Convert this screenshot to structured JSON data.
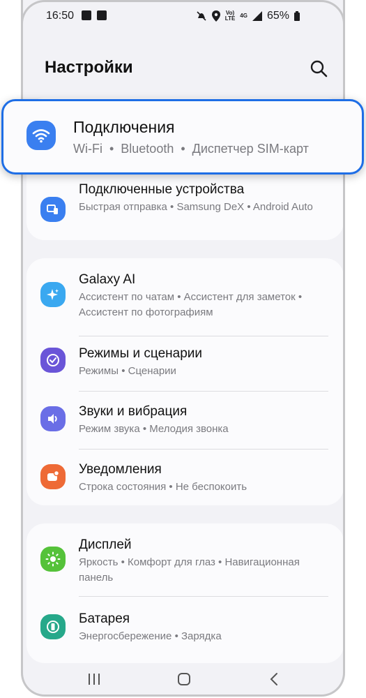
{
  "status_bar": {
    "time": "16:50",
    "sig_label": "Vo)\nLTE",
    "net": "4G",
    "battery": "65%"
  },
  "header": {
    "title": "Настройки"
  },
  "highlighted": {
    "title": "Подключения",
    "subtitle": "Wi-Fi  •  Bluetooth  •  Диспетчер SIM-карт",
    "icon_color": "#3a7ff0"
  },
  "group1": [
    {
      "title": "Подключенные устройства",
      "subtitle": "Быстрая отправка  •  Samsung DeX  •  Android Auto",
      "icon": "devices-icon",
      "color": "#3a7ff0"
    }
  ],
  "group2": [
    {
      "title": "Galaxy AI",
      "subtitle": "Ассистент по чатам  •  Ассистент для заметок  •  Ассистент по фотографиям",
      "icon": "sparkle-icon",
      "color": "#3aa8f0"
    },
    {
      "title": "Режимы и сценарии",
      "subtitle": "Режимы  •  Сценарии",
      "icon": "check-circle-icon",
      "color": "#6a55d8"
    },
    {
      "title": "Звуки и вибрация",
      "subtitle": "Режим звука  •  Мелодия звонка",
      "icon": "volume-icon",
      "color": "#6a6ee6"
    },
    {
      "title": "Уведомления",
      "subtitle": "Строка состояния  •  Не беспокоить",
      "icon": "notification-icon",
      "color": "#ee6a36"
    }
  ],
  "group3": [
    {
      "title": "Дисплей",
      "subtitle": "Яркость  •  Комфорт для глаз  •  Навигационная панель",
      "icon": "brightness-icon",
      "color": "#55c23a"
    },
    {
      "title": "Батарея",
      "subtitle": "Энергосбережение  •  Зарядка",
      "icon": "battery-icon",
      "color": "#26a88a"
    }
  ]
}
